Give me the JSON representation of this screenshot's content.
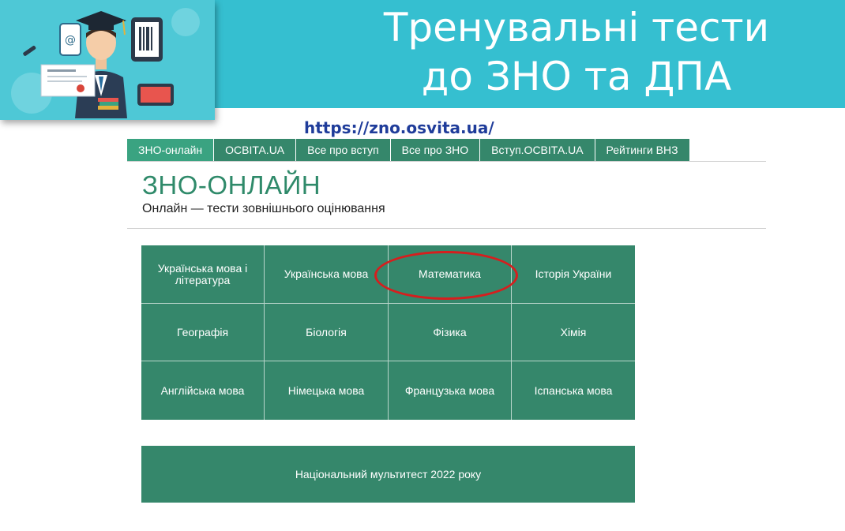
{
  "slide": {
    "title_line1": "Тренувальні тести",
    "title_line2": "до ЗНО та ДПА",
    "url": "https://zno.osvita.ua/",
    "illustration_icon": "graduate-with-devices-icon"
  },
  "nav": {
    "items": [
      {
        "label": "ЗНО-онлайн",
        "active": true
      },
      {
        "label": "ОСВІТА.UA"
      },
      {
        "label": "Все про вступ"
      },
      {
        "label": "Все про ЗНО"
      },
      {
        "label": "Вступ.ОСВІТА.UA"
      },
      {
        "label": "Рейтинги ВНЗ"
      }
    ]
  },
  "header": {
    "title": "ЗНО-ОНЛАЙН",
    "subtitle": "Онлайн — тести зовнішнього оцінювання"
  },
  "subjects": [
    {
      "label": "Українська мова і література"
    },
    {
      "label": "Українська мова"
    },
    {
      "label": "Математика",
      "highlighted": true
    },
    {
      "label": "Історія України"
    },
    {
      "label": "Географія"
    },
    {
      "label": "Біологія"
    },
    {
      "label": "Фізика"
    },
    {
      "label": "Хімія"
    },
    {
      "label": "Англійська мова"
    },
    {
      "label": "Німецька мова"
    },
    {
      "label": "Французька мова"
    },
    {
      "label": "Іспанська мова"
    }
  ],
  "multitest": {
    "label": "Національний мультитест 2022 року"
  },
  "colors": {
    "banner": "#35bfd0",
    "tile_green": "#35876b",
    "nav_active": "#3aa381",
    "title_green": "#2f8a6a",
    "url_blue": "#1f3c9a",
    "highlight_red": "#d61e1e"
  }
}
